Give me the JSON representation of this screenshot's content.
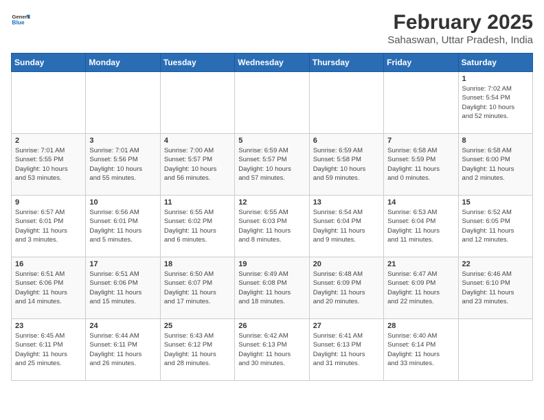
{
  "logo": {
    "general": "General",
    "blue": "Blue"
  },
  "title": "February 2025",
  "subtitle": "Sahaswan, Uttar Pradesh, India",
  "weekdays": [
    "Sunday",
    "Monday",
    "Tuesday",
    "Wednesday",
    "Thursday",
    "Friday",
    "Saturday"
  ],
  "weeks": [
    [
      {
        "day": "",
        "content": ""
      },
      {
        "day": "",
        "content": ""
      },
      {
        "day": "",
        "content": ""
      },
      {
        "day": "",
        "content": ""
      },
      {
        "day": "",
        "content": ""
      },
      {
        "day": "",
        "content": ""
      },
      {
        "day": "1",
        "content": "Sunrise: 7:02 AM\nSunset: 5:54 PM\nDaylight: 10 hours\nand 52 minutes."
      }
    ],
    [
      {
        "day": "2",
        "content": "Sunrise: 7:01 AM\nSunset: 5:55 PM\nDaylight: 10 hours\nand 53 minutes."
      },
      {
        "day": "3",
        "content": "Sunrise: 7:01 AM\nSunset: 5:56 PM\nDaylight: 10 hours\nand 55 minutes."
      },
      {
        "day": "4",
        "content": "Sunrise: 7:00 AM\nSunset: 5:57 PM\nDaylight: 10 hours\nand 56 minutes."
      },
      {
        "day": "5",
        "content": "Sunrise: 6:59 AM\nSunset: 5:57 PM\nDaylight: 10 hours\nand 57 minutes."
      },
      {
        "day": "6",
        "content": "Sunrise: 6:59 AM\nSunset: 5:58 PM\nDaylight: 10 hours\nand 59 minutes."
      },
      {
        "day": "7",
        "content": "Sunrise: 6:58 AM\nSunset: 5:59 PM\nDaylight: 11 hours\nand 0 minutes."
      },
      {
        "day": "8",
        "content": "Sunrise: 6:58 AM\nSunset: 6:00 PM\nDaylight: 11 hours\nand 2 minutes."
      }
    ],
    [
      {
        "day": "9",
        "content": "Sunrise: 6:57 AM\nSunset: 6:01 PM\nDaylight: 11 hours\nand 3 minutes."
      },
      {
        "day": "10",
        "content": "Sunrise: 6:56 AM\nSunset: 6:01 PM\nDaylight: 11 hours\nand 5 minutes."
      },
      {
        "day": "11",
        "content": "Sunrise: 6:55 AM\nSunset: 6:02 PM\nDaylight: 11 hours\nand 6 minutes."
      },
      {
        "day": "12",
        "content": "Sunrise: 6:55 AM\nSunset: 6:03 PM\nDaylight: 11 hours\nand 8 minutes."
      },
      {
        "day": "13",
        "content": "Sunrise: 6:54 AM\nSunset: 6:04 PM\nDaylight: 11 hours\nand 9 minutes."
      },
      {
        "day": "14",
        "content": "Sunrise: 6:53 AM\nSunset: 6:04 PM\nDaylight: 11 hours\nand 11 minutes."
      },
      {
        "day": "15",
        "content": "Sunrise: 6:52 AM\nSunset: 6:05 PM\nDaylight: 11 hours\nand 12 minutes."
      }
    ],
    [
      {
        "day": "16",
        "content": "Sunrise: 6:51 AM\nSunset: 6:06 PM\nDaylight: 11 hours\nand 14 minutes."
      },
      {
        "day": "17",
        "content": "Sunrise: 6:51 AM\nSunset: 6:06 PM\nDaylight: 11 hours\nand 15 minutes."
      },
      {
        "day": "18",
        "content": "Sunrise: 6:50 AM\nSunset: 6:07 PM\nDaylight: 11 hours\nand 17 minutes."
      },
      {
        "day": "19",
        "content": "Sunrise: 6:49 AM\nSunset: 6:08 PM\nDaylight: 11 hours\nand 18 minutes."
      },
      {
        "day": "20",
        "content": "Sunrise: 6:48 AM\nSunset: 6:09 PM\nDaylight: 11 hours\nand 20 minutes."
      },
      {
        "day": "21",
        "content": "Sunrise: 6:47 AM\nSunset: 6:09 PM\nDaylight: 11 hours\nand 22 minutes."
      },
      {
        "day": "22",
        "content": "Sunrise: 6:46 AM\nSunset: 6:10 PM\nDaylight: 11 hours\nand 23 minutes."
      }
    ],
    [
      {
        "day": "23",
        "content": "Sunrise: 6:45 AM\nSunset: 6:11 PM\nDaylight: 11 hours\nand 25 minutes."
      },
      {
        "day": "24",
        "content": "Sunrise: 6:44 AM\nSunset: 6:11 PM\nDaylight: 11 hours\nand 26 minutes."
      },
      {
        "day": "25",
        "content": "Sunrise: 6:43 AM\nSunset: 6:12 PM\nDaylight: 11 hours\nand 28 minutes."
      },
      {
        "day": "26",
        "content": "Sunrise: 6:42 AM\nSunset: 6:13 PM\nDaylight: 11 hours\nand 30 minutes."
      },
      {
        "day": "27",
        "content": "Sunrise: 6:41 AM\nSunset: 6:13 PM\nDaylight: 11 hours\nand 31 minutes."
      },
      {
        "day": "28",
        "content": "Sunrise: 6:40 AM\nSunset: 6:14 PM\nDaylight: 11 hours\nand 33 minutes."
      },
      {
        "day": "",
        "content": ""
      }
    ]
  ]
}
